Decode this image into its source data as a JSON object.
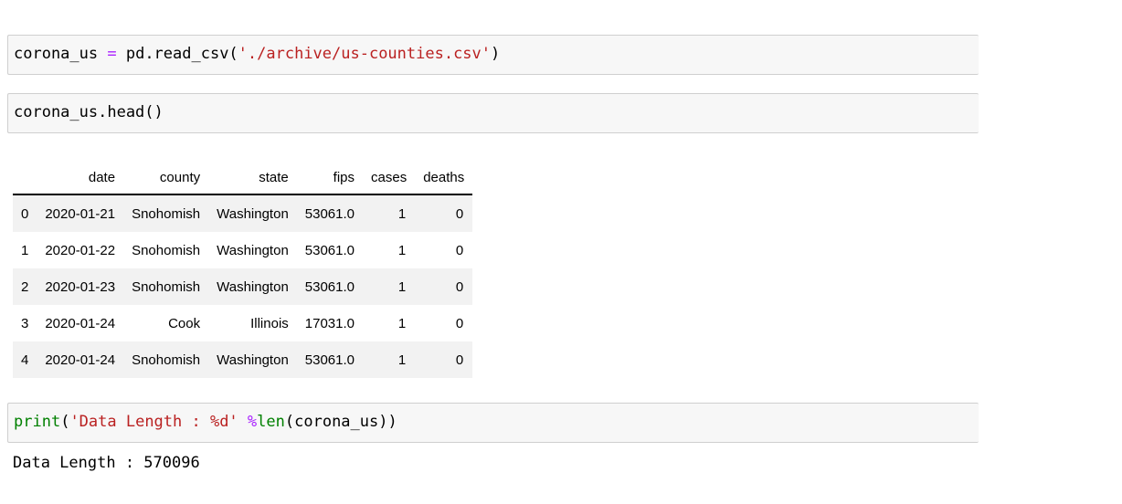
{
  "cells": [
    {
      "id": "cell1",
      "tokens": [
        {
          "text": "corona_us ",
          "cls": ""
        },
        {
          "text": "=",
          "cls": "op"
        },
        {
          "text": " pd.read_csv(",
          "cls": ""
        },
        {
          "text": "'./archive/us-counties.csv'",
          "cls": "str"
        },
        {
          "text": ")",
          "cls": ""
        }
      ]
    },
    {
      "id": "cell2",
      "tokens": [
        {
          "text": "corona_us.head()",
          "cls": ""
        }
      ]
    },
    {
      "id": "cell3",
      "tokens": [
        {
          "text": "print",
          "cls": "kw"
        },
        {
          "text": "(",
          "cls": ""
        },
        {
          "text": "'Data Length : %d'",
          "cls": "str"
        },
        {
          "text": " ",
          "cls": ""
        },
        {
          "text": "%",
          "cls": "op"
        },
        {
          "text": "len",
          "cls": "kw"
        },
        {
          "text": "(corona_us))",
          "cls": ""
        }
      ]
    }
  ],
  "dataframe": {
    "columns": [
      "",
      "date",
      "county",
      "state",
      "fips",
      "cases",
      "deaths"
    ],
    "rows": [
      [
        "0",
        "2020-01-21",
        "Snohomish",
        "Washington",
        "53061.0",
        "1",
        "0"
      ],
      [
        "1",
        "2020-01-22",
        "Snohomish",
        "Washington",
        "53061.0",
        "1",
        "0"
      ],
      [
        "2",
        "2020-01-23",
        "Snohomish",
        "Washington",
        "53061.0",
        "1",
        "0"
      ],
      [
        "3",
        "2020-01-24",
        "Cook",
        "Illinois",
        "17031.0",
        "1",
        "0"
      ],
      [
        "4",
        "2020-01-24",
        "Snohomish",
        "Washington",
        "53061.0",
        "1",
        "0"
      ]
    ]
  },
  "output": {
    "text": "Data Length : 570096"
  }
}
